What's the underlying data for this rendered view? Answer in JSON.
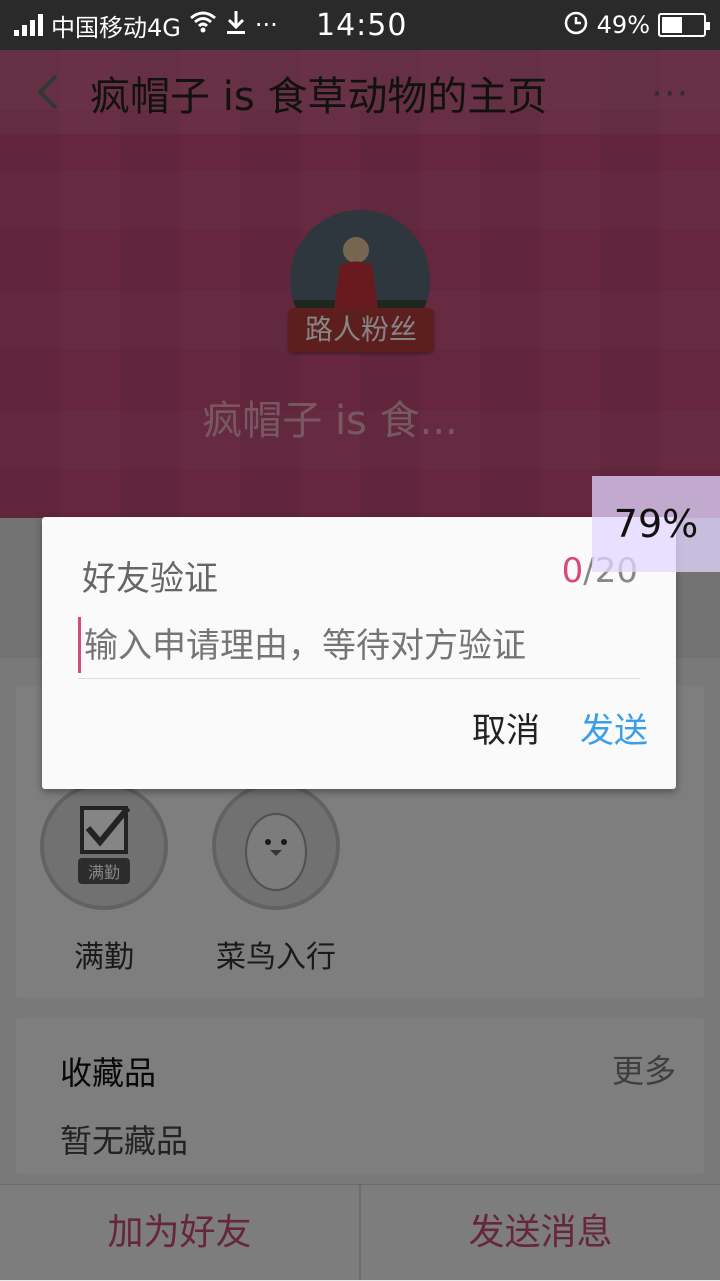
{
  "status_bar": {
    "carrier": "中国移动4G",
    "time": "14:50",
    "battery": "49%",
    "battery_level": 0.49
  },
  "header": {
    "title": "疯帽子 is 食草动物的主页",
    "more_label": "···"
  },
  "profile": {
    "badge": "路人粉丝",
    "username": "疯帽子 is 食..."
  },
  "medals": [
    {
      "label": "满勤",
      "icon_text": "满勤"
    },
    {
      "label": "菜鸟入行"
    }
  ],
  "collection": {
    "heading": "收藏品",
    "more": "更多",
    "empty": "暂无藏品"
  },
  "bottom_bar": {
    "add_friend": "加为好友",
    "send_message": "发送消息"
  },
  "dialog": {
    "title": "好友验证",
    "counter_current": "0",
    "counter_max": "/20",
    "placeholder": "输入申请理由，等待对方验证",
    "cancel": "取消",
    "send": "发送"
  },
  "overlay_percent": "79%",
  "colors": {
    "brand": "#c24a78",
    "accent_link": "#3b9ee8",
    "counter_highlight": "#d9487a"
  }
}
